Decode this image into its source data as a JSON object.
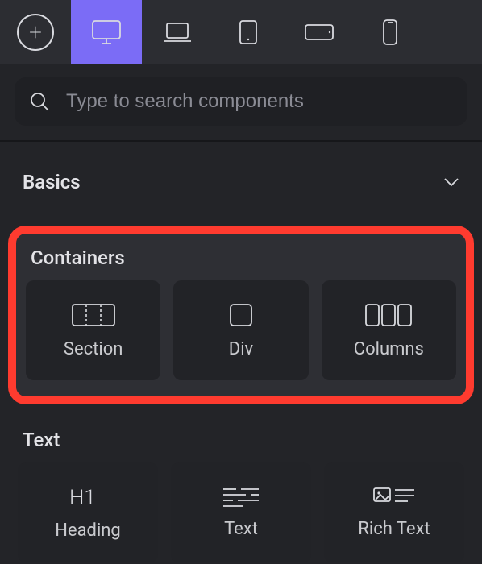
{
  "topbar": {
    "items": [
      {
        "name": "add-button",
        "icon": "plus"
      },
      {
        "name": "device-desktop",
        "icon": "monitor",
        "active": true
      },
      {
        "name": "device-laptop",
        "icon": "laptop"
      },
      {
        "name": "device-tablet",
        "icon": "tablet"
      },
      {
        "name": "device-landscape",
        "icon": "landscape"
      },
      {
        "name": "device-phone",
        "icon": "phone"
      }
    ]
  },
  "search": {
    "placeholder": "Type to search components",
    "value": ""
  },
  "categories": {
    "basics": {
      "label": "Basics",
      "collapsed": true
    }
  },
  "groups": {
    "containers": {
      "label": "Containers",
      "highlighted": true,
      "tiles": [
        {
          "name": "tile-section",
          "label": "Section"
        },
        {
          "name": "tile-div",
          "label": "Div"
        },
        {
          "name": "tile-columns",
          "label": "Columns"
        }
      ]
    },
    "text": {
      "label": "Text",
      "tiles": [
        {
          "name": "tile-heading",
          "label": "Heading"
        },
        {
          "name": "tile-text",
          "label": "Text"
        },
        {
          "name": "tile-richtext",
          "label": "Rich Text"
        }
      ]
    }
  },
  "colors": {
    "accent": "#7b6cf6",
    "highlight": "#ff3b2f"
  }
}
